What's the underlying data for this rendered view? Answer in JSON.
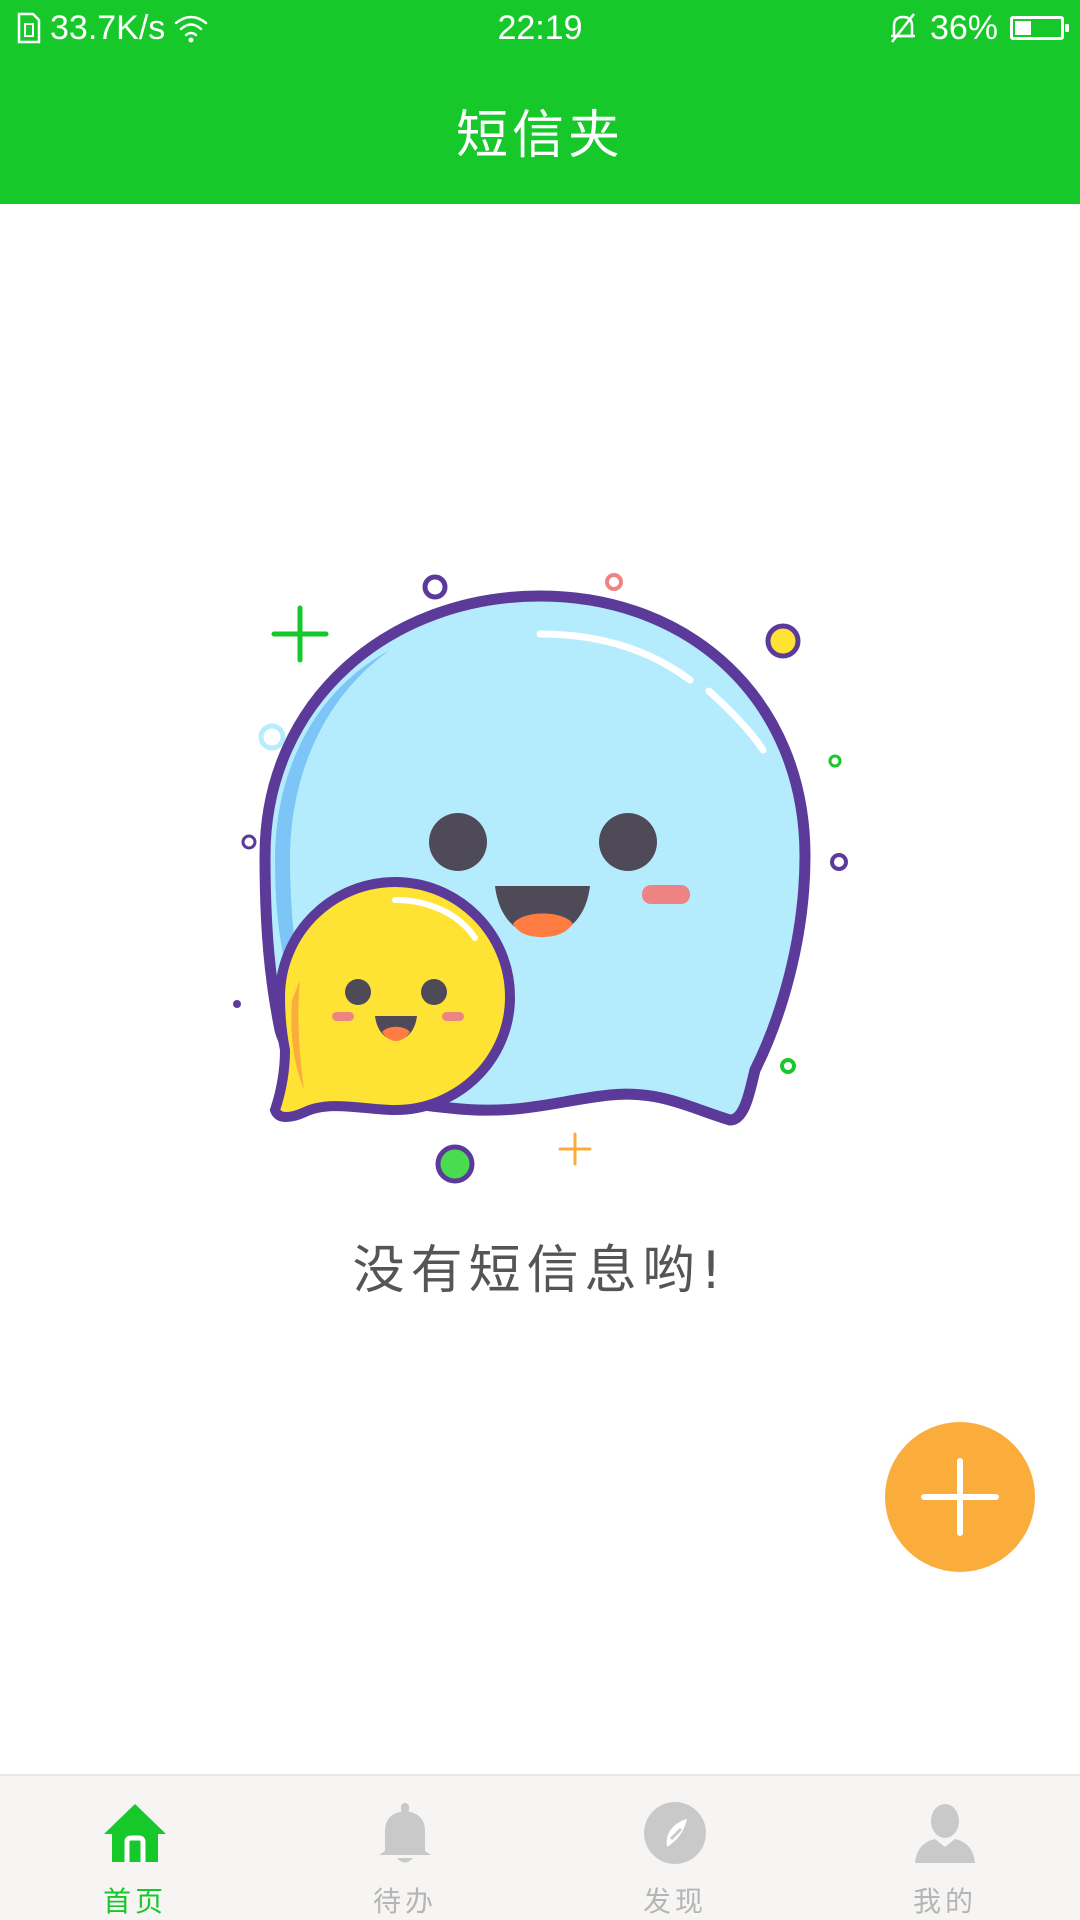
{
  "status_bar": {
    "network_speed": "33.7K/s",
    "time": "22:19",
    "battery_percent": "36%",
    "battery_level": 0.36,
    "icons": [
      "sim-icon",
      "wifi-icon",
      "bell-muted-icon",
      "battery-icon"
    ]
  },
  "header": {
    "title": "短信夹",
    "background_color": "#17c82a"
  },
  "empty_state": {
    "message": "没有短信息哟!",
    "illustration": "chat-bubbles-illustration"
  },
  "fab": {
    "icon": "plus-icon",
    "color": "#fbad3b"
  },
  "bottom_nav": {
    "active_color": "#17c82a",
    "inactive_color": "#b5b5b5",
    "items": [
      {
        "label": "首页",
        "icon": "home-icon",
        "active": true
      },
      {
        "label": "待办",
        "icon": "bell-icon",
        "active": false
      },
      {
        "label": "发现",
        "icon": "compass-icon",
        "active": false
      },
      {
        "label": "我的",
        "icon": "user-icon",
        "active": false
      }
    ]
  }
}
